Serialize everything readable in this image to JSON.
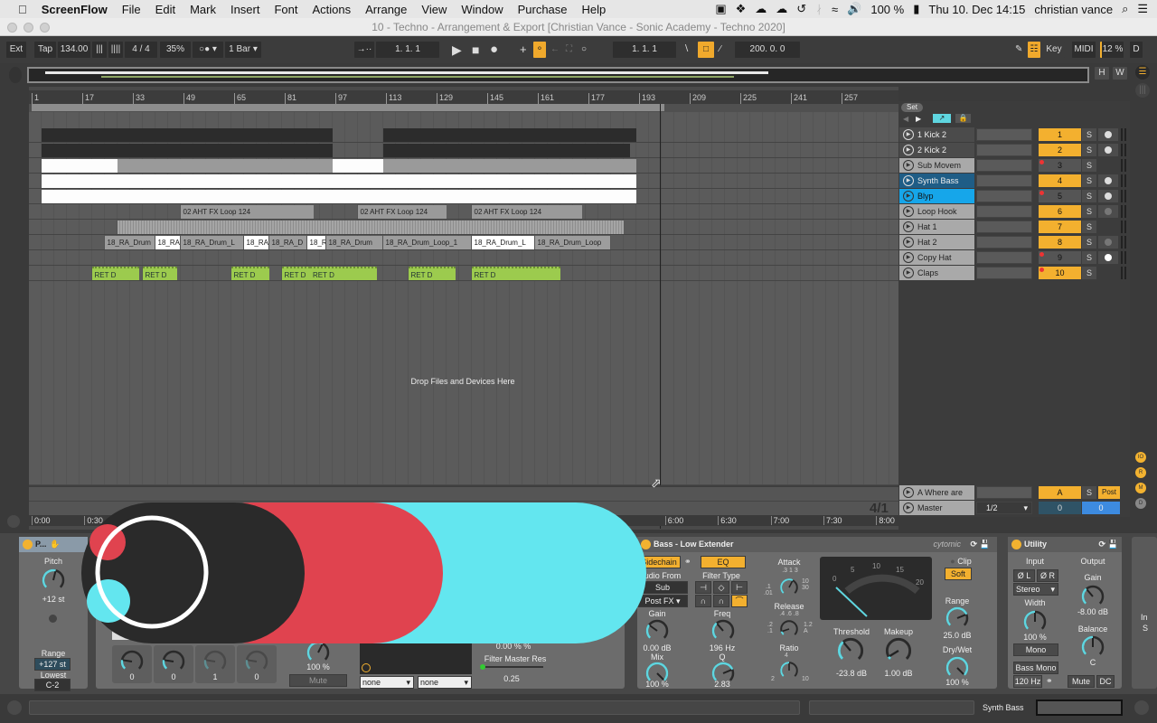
{
  "menubar": {
    "apple": "",
    "app": "ScreenFlow",
    "items": [
      "File",
      "Edit",
      "Mark",
      "Insert",
      "Font",
      "Actions",
      "Arrange",
      "View",
      "Window",
      "Purchase",
      "Help"
    ],
    "battery": "100 %",
    "datetime": "Thu 10. Dec  14:15",
    "user": "christian vance"
  },
  "window": {
    "title": "10 - Techno - Arrangement & Export  [Christian Vance - Sonic Academy - Techno 2020]"
  },
  "toolbar": {
    "ext": "Ext",
    "tap": "Tap",
    "tempo": "134.00",
    "nudge_down": "|||",
    "nudge_up": "||||",
    "signature": "4 / 4",
    "metronome_swing": "35%",
    "metro": "○●",
    "quantize": "1 Bar",
    "follow": "→··",
    "position": "1.  1.  1",
    "loop_start": "1.  1.  1",
    "loop_length": "200.  0.  0",
    "key": "Key",
    "midi": "MIDI",
    "cpu": "12 %",
    "disk": "D",
    "h": "H",
    "w": "W"
  },
  "ruler": {
    "bars": [
      1,
      17,
      33,
      49,
      65,
      81,
      97,
      113,
      129,
      145,
      161,
      177,
      193,
      209,
      225,
      241,
      257
    ]
  },
  "arrangement": {
    "drop_text": "Drop Files and Devices Here",
    "loop": [
      1,
      201
    ],
    "cursor_bar": 200
  },
  "lanes": [
    {
      "clips": [
        {
          "s": 4,
          "e": 76,
          "c": "dark"
        },
        {
          "s": 76,
          "e": 96,
          "c": "dark"
        },
        {
          "s": 112,
          "e": 192,
          "c": "dark"
        }
      ]
    },
    {
      "clips": [
        {
          "s": 4,
          "e": 76,
          "c": "dark"
        },
        {
          "s": 76,
          "e": 96,
          "c": "dark"
        },
        {
          "s": 112,
          "e": 190,
          "c": "dark"
        }
      ]
    },
    {
      "clips": [
        {
          "s": 4,
          "e": 28,
          "c": "white"
        },
        {
          "s": 28,
          "e": 96,
          "c": "gray"
        },
        {
          "s": 96,
          "e": 112,
          "c": "white"
        },
        {
          "s": 112,
          "e": 192,
          "c": "gray"
        }
      ]
    },
    {
      "clips": [
        {
          "s": 4,
          "e": 192,
          "c": "white"
        }
      ]
    },
    {
      "clips": [
        {
          "s": 4,
          "e": 192,
          "c": "white"
        }
      ]
    },
    {
      "clips": [
        {
          "s": 48,
          "e": 90,
          "c": "gray",
          "label": "02 AHT FX Loop 124"
        },
        {
          "s": 104,
          "e": 132,
          "c": "gray",
          "label": "02 AHT FX Loop 124"
        },
        {
          "s": 140,
          "e": 175,
          "c": "gray",
          "label": "02 AHT FX Loop 124"
        }
      ]
    },
    {
      "clips": [
        {
          "s": 28,
          "e": 188,
          "c": "hatch"
        }
      ]
    },
    {
      "clips": [
        {
          "s": 24,
          "e": 40,
          "c": "drum",
          "label": "18_RA_Drum"
        },
        {
          "s": 40,
          "e": 48,
          "c": "drum white",
          "label": "18_RA"
        },
        {
          "s": 48,
          "e": 68,
          "c": "drum",
          "label": "18_RA_Drum_L"
        },
        {
          "s": 68,
          "e": 76,
          "c": "drum white",
          "label": "18_RA"
        },
        {
          "s": 76,
          "e": 88,
          "c": "drum",
          "label": "18_RA_D"
        },
        {
          "s": 88,
          "e": 94,
          "c": "drum white",
          "label": "18_R"
        },
        {
          "s": 94,
          "e": 112,
          "c": "drum",
          "label": "18_RA_Drum"
        },
        {
          "s": 112,
          "e": 140,
          "c": "drum",
          "label": "18_RA_Drum_Loop_1"
        },
        {
          "s": 140,
          "e": 160,
          "c": "drum white",
          "label": "18_RA_Drum_L"
        },
        {
          "s": 160,
          "e": 184,
          "c": "drum",
          "label": "18_RA_Drum_Loop"
        }
      ]
    },
    {
      "clips": []
    },
    {
      "clips": [
        {
          "s": 20,
          "e": 35,
          "c": "green",
          "label": "RET D"
        },
        {
          "s": 36,
          "e": 47,
          "c": "green",
          "label": "RET D"
        },
        {
          "s": 64,
          "e": 76,
          "c": "green",
          "label": "RET D"
        },
        {
          "s": 80,
          "e": 89,
          "c": "green",
          "label": "RET D"
        },
        {
          "s": 89,
          "e": 110,
          "c": "green",
          "label": "RET D"
        },
        {
          "s": 120,
          "e": 135,
          "c": "green",
          "label": "RET D"
        },
        {
          "s": 140,
          "e": 168,
          "c": "green",
          "label": "RET D"
        }
      ]
    }
  ],
  "tracklist": {
    "set": "Set",
    "tracks": [
      {
        "name": "1 Kick 2",
        "num": "1",
        "style": "dk",
        "armed": true,
        "rec": false,
        "mon": "half"
      },
      {
        "name": "2 Kick 2",
        "num": "2",
        "style": "dk",
        "armed": true,
        "rec": false,
        "mon": "half"
      },
      {
        "name": "Sub Movem",
        "num": "3",
        "style": "",
        "armed": false,
        "rec": true,
        "mon": "none"
      },
      {
        "name": "Synth Bass",
        "num": "4",
        "style": "sel1",
        "armed": true,
        "rec": false,
        "mon": "half"
      },
      {
        "name": "Blyp",
        "num": "5",
        "style": "sel2",
        "armed": false,
        "rec": true,
        "mon": "half"
      },
      {
        "name": "Loop Hook",
        "num": "6",
        "style": "",
        "armed": true,
        "rec": false,
        "mon": "dim"
      },
      {
        "name": "Hat 1",
        "num": "7",
        "style": "",
        "armed": true,
        "rec": false,
        "mon": "none"
      },
      {
        "name": "Hat 2",
        "num": "8",
        "style": "",
        "armed": true,
        "rec": false,
        "mon": "dim"
      },
      {
        "name": "Copy Hat",
        "num": "9",
        "style": "",
        "armed": false,
        "rec": true,
        "mon": "white"
      },
      {
        "name": "Claps",
        "num": "10",
        "style": "",
        "armed": true,
        "rec": true,
        "mon": "none"
      }
    ],
    "solo": "S",
    "return": {
      "name": "A Where are",
      "num": "A",
      "solo": "S",
      "post": "Post"
    },
    "master": {
      "name": "Master",
      "cue": "1/2",
      "vol1": "0",
      "vol2": "0",
      "signature": "4/1"
    },
    "side_buttons": [
      "IO",
      "R",
      "M",
      "D"
    ]
  },
  "timeruler": {
    "labels": [
      "0:00",
      "0:30",
      "6:00",
      "6:30",
      "7:00",
      "7:30",
      "8:00"
    ],
    "seconds": [
      0,
      30,
      360,
      390,
      420,
      450,
      480
    ]
  },
  "devices": {
    "pitch": {
      "title": "P...",
      "pitch_label": "Pitch",
      "pitch_value": "+12 st",
      "range_label": "Range",
      "range_value": "+127 st",
      "lowest_label": "Lowest",
      "lowest_value": "C-2"
    },
    "middle": {
      "macros": [
        "0",
        "0",
        "1",
        "0"
      ],
      "vol": "100 %",
      "mute": "Mute",
      "sel1": "none",
      "sel2": "none",
      "pct": "0.00 % %",
      "res_label": "Filter Master Res",
      "res_value": "0.25"
    },
    "glue": {
      "title": "Bass - Low Extender",
      "brand": "cytomic",
      "sidechain": "Sidechain",
      "eq": "EQ",
      "audio_from": "Audio From",
      "src": "Sub Moveme",
      "tap": "Post FX",
      "filter_type": "Filter Type",
      "gain_label": "Gain",
      "gain": "0.00 dB",
      "mix_label": "Mix",
      "mix": "100 %",
      "freq_label": "Freq",
      "freq": "196 Hz",
      "q_label": "Q",
      "q": "2.83",
      "attack": "Attack",
      "attack_scale": [
        ".01",
        ".1",
        ".3",
        "1",
        "3",
        "10",
        "30"
      ],
      "release": "Release",
      "release_scale": [
        ".1",
        ".2",
        ".4",
        ".6",
        ".8",
        "1.2",
        "A"
      ],
      "ratio": "Ratio",
      "ratio_scale": [
        "2",
        "4",
        "10"
      ],
      "meter_scale": [
        "0",
        "5",
        "10",
        "15",
        "20"
      ],
      "threshold_label": "Threshold",
      "threshold": "-23.8 dB",
      "makeup_label": "Makeup",
      "makeup": "1.00 dB",
      "clip": "Clip",
      "soft": "Soft",
      "range_label": "Range",
      "range": "25.0 dB",
      "drywet_label": "Dry/Wet",
      "drywet": "100 %"
    },
    "utility": {
      "title": "Utility",
      "input": "Input",
      "output": "Output",
      "phl": "Ø L",
      "phr": "Ø R",
      "mode": "Stereo",
      "width_label": "Width",
      "width": "100 %",
      "mono": "Mono",
      "bass_mono": "Bass Mono",
      "bass_freq": "120 Hz",
      "gain_label": "Gain",
      "gain": "-8.00 dB",
      "balance_label": "Balance",
      "balance": "C",
      "mute": "Mute",
      "dc": "DC"
    },
    "partial": {
      "a": "In",
      "b": "S"
    },
    "knob_levels": {
      "pitch": 0.55,
      "m1": 0.2,
      "m2": 0.2,
      "m3": 0.2,
      "m4": 0.2,
      "vol": 0.6,
      "gain": 0.3,
      "mix": 1,
      "freq": 0.35,
      "q": 0.75,
      "attack": 0.6,
      "release": 0.1,
      "ratio": 0.5,
      "threshold": 0.35,
      "makeup": 0.05,
      "range": 0.75,
      "drywet": 1,
      "width": 0.5,
      "ugain": 0.35,
      "balance": 0.5
    }
  },
  "statusbar": {
    "track": "Synth Bass"
  },
  "colors": {
    "accent": "#f3b02f",
    "select_blue": "#16a6ea",
    "clip_green": "#9ccb4e",
    "knob": "#5fd6e0",
    "logo_cyan": "#63e6ef",
    "logo_red": "#e0434f",
    "logo_dark": "#2a2a2a"
  }
}
